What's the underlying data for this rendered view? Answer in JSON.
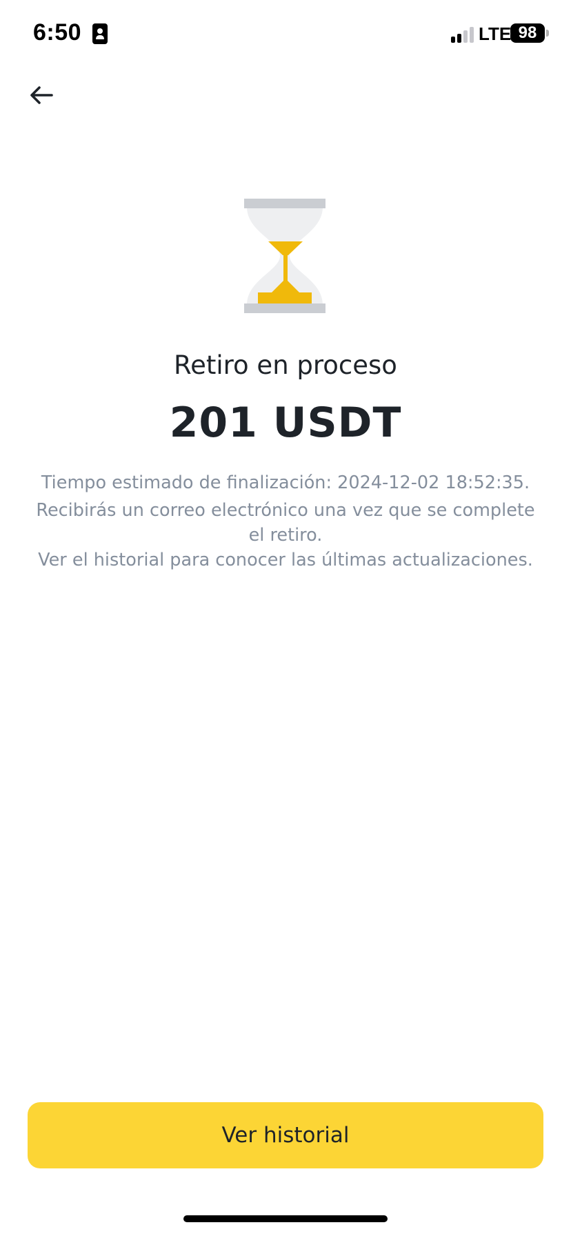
{
  "status_bar": {
    "time": "6:50",
    "network": "LTE",
    "battery": "98",
    "icons": {
      "id_card": "contact-card-icon",
      "signal": "cellular-signal-icon",
      "battery": "battery-icon"
    },
    "signal_bars_active": 2,
    "signal_bars_total": 4
  },
  "header": {
    "back_icon": "arrow-left-icon"
  },
  "main": {
    "status_icon": "hourglass-icon",
    "title": "Retiro en proceso",
    "amount": "201 USDT",
    "estimated_time": "Tiempo estimado de finalización: 2024-12-02 18:52:35.",
    "email_notice": "Recibirás un correo electrónico una vez que se complete el retiro.",
    "history_notice": "Ver el historial para conocer las últimas actualizaciones."
  },
  "footer": {
    "primary_button_label": "Ver historial"
  },
  "colors": {
    "accent": "#fcd535",
    "hourglass_sand": "#f0b90b",
    "hourglass_frame": "#cacdd2",
    "hourglass_glass": "#eeeff1",
    "text_primary": "#1e2329",
    "text_secondary": "#848e9c"
  }
}
